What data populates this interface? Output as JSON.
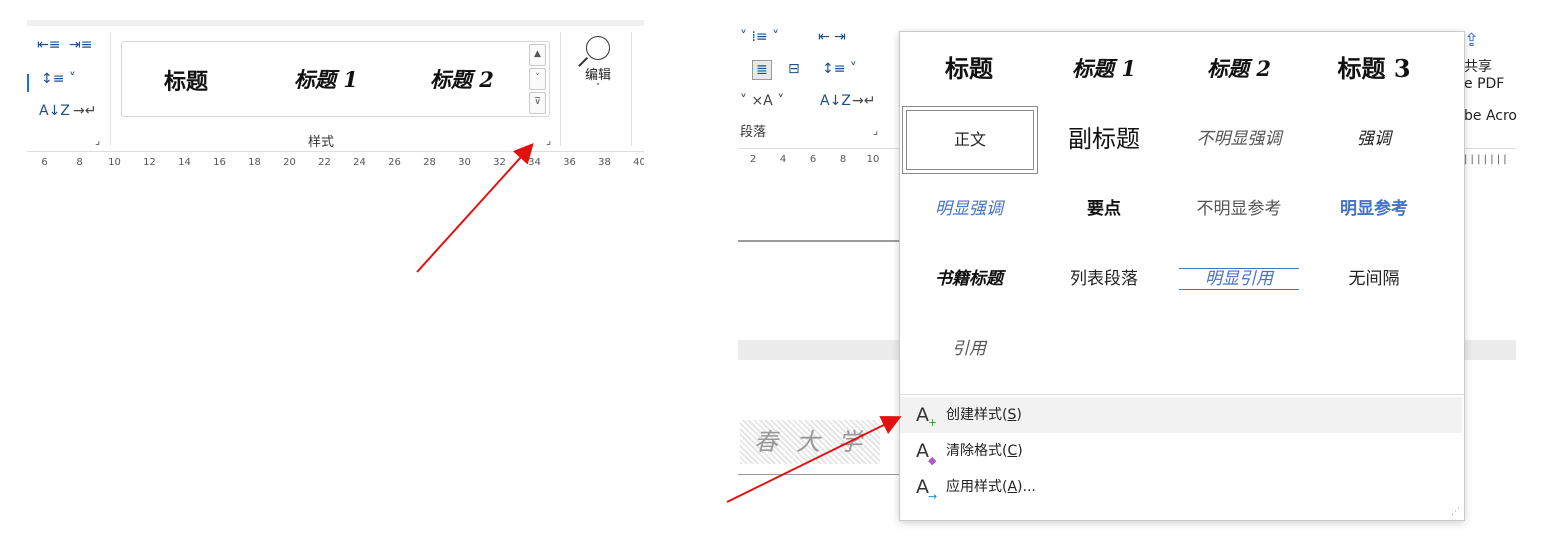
{
  "left": {
    "gallery_styles": [
      "标题",
      "标题 1",
      "标题 2"
    ],
    "group_label": "样式",
    "edit_label": "编辑",
    "ruler_ticks": [
      "6",
      "8",
      "10",
      "12",
      "14",
      "16",
      "18",
      "20",
      "22",
      "24",
      "26",
      "28",
      "30",
      "32",
      "34",
      "36",
      "38",
      "40"
    ]
  },
  "right": {
    "paragraph_label": "段落",
    "ruler_ticks": [
      "2",
      "4",
      "6",
      "8",
      "10"
    ],
    "share_text": [
      "共享",
      "e PDF",
      "be Acro"
    ],
    "seal_text": "春大学"
  },
  "dropdown": {
    "styles": [
      {
        "label": "标题",
        "kind": "title"
      },
      {
        "label": "标题 1",
        "kind": "heading1"
      },
      {
        "label": "标题 2",
        "kind": "heading2"
      },
      {
        "label": "标题 3",
        "kind": "heading3"
      },
      {
        "label": "正文",
        "kind": "normal",
        "selected": true
      },
      {
        "label": "副标题",
        "kind": "subtitle"
      },
      {
        "label": "不明显强调",
        "kind": "subtle-emphasis"
      },
      {
        "label": "强调",
        "kind": "emphasis"
      },
      {
        "label": "明显强调",
        "kind": "intense-emphasis"
      },
      {
        "label": "要点",
        "kind": "strong"
      },
      {
        "label": "不明显参考",
        "kind": "subtle-reference"
      },
      {
        "label": "明显参考",
        "kind": "intense-reference"
      },
      {
        "label": "书籍标题",
        "kind": "book-title"
      },
      {
        "label": "列表段落",
        "kind": "list-paragraph"
      },
      {
        "label": "明显引用",
        "kind": "intense-quote"
      },
      {
        "label": "无间隔",
        "kind": "no-spacing"
      },
      {
        "label": "引用",
        "kind": "quote"
      }
    ],
    "menu": [
      {
        "label": "创建样式(S)",
        "key": "S",
        "icon": "create-style-icon"
      },
      {
        "label": "清除格式(C)",
        "key": "C",
        "icon": "clear-format-icon"
      },
      {
        "label": "应用样式(A)...",
        "key": "A",
        "icon": "apply-style-icon"
      }
    ]
  },
  "colors": {
    "accent_blue": "#4472c4",
    "arrow_red": "#e31010"
  }
}
